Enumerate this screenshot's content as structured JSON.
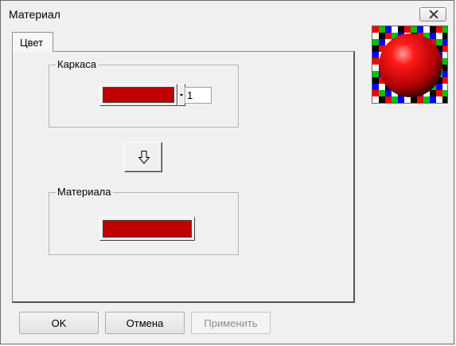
{
  "window": {
    "title": "Материал"
  },
  "tabs": [
    {
      "label": "Цвет"
    }
  ],
  "frame_group": {
    "label": "Каркаса",
    "color": "#c00000",
    "width_value": "1"
  },
  "material_group": {
    "label": "Материала",
    "color": "#c00000"
  },
  "buttons": {
    "ok": "OK",
    "cancel": "Отмена",
    "apply": "Применить"
  },
  "colors": {
    "preview_sphere": "#e00000",
    "checker": [
      "#ff0000",
      "#00c000",
      "#0000ff",
      "#ffffff",
      "#000000"
    ]
  },
  "icons": {
    "close": "close-icon",
    "arrow": "arrow-down-icon"
  }
}
